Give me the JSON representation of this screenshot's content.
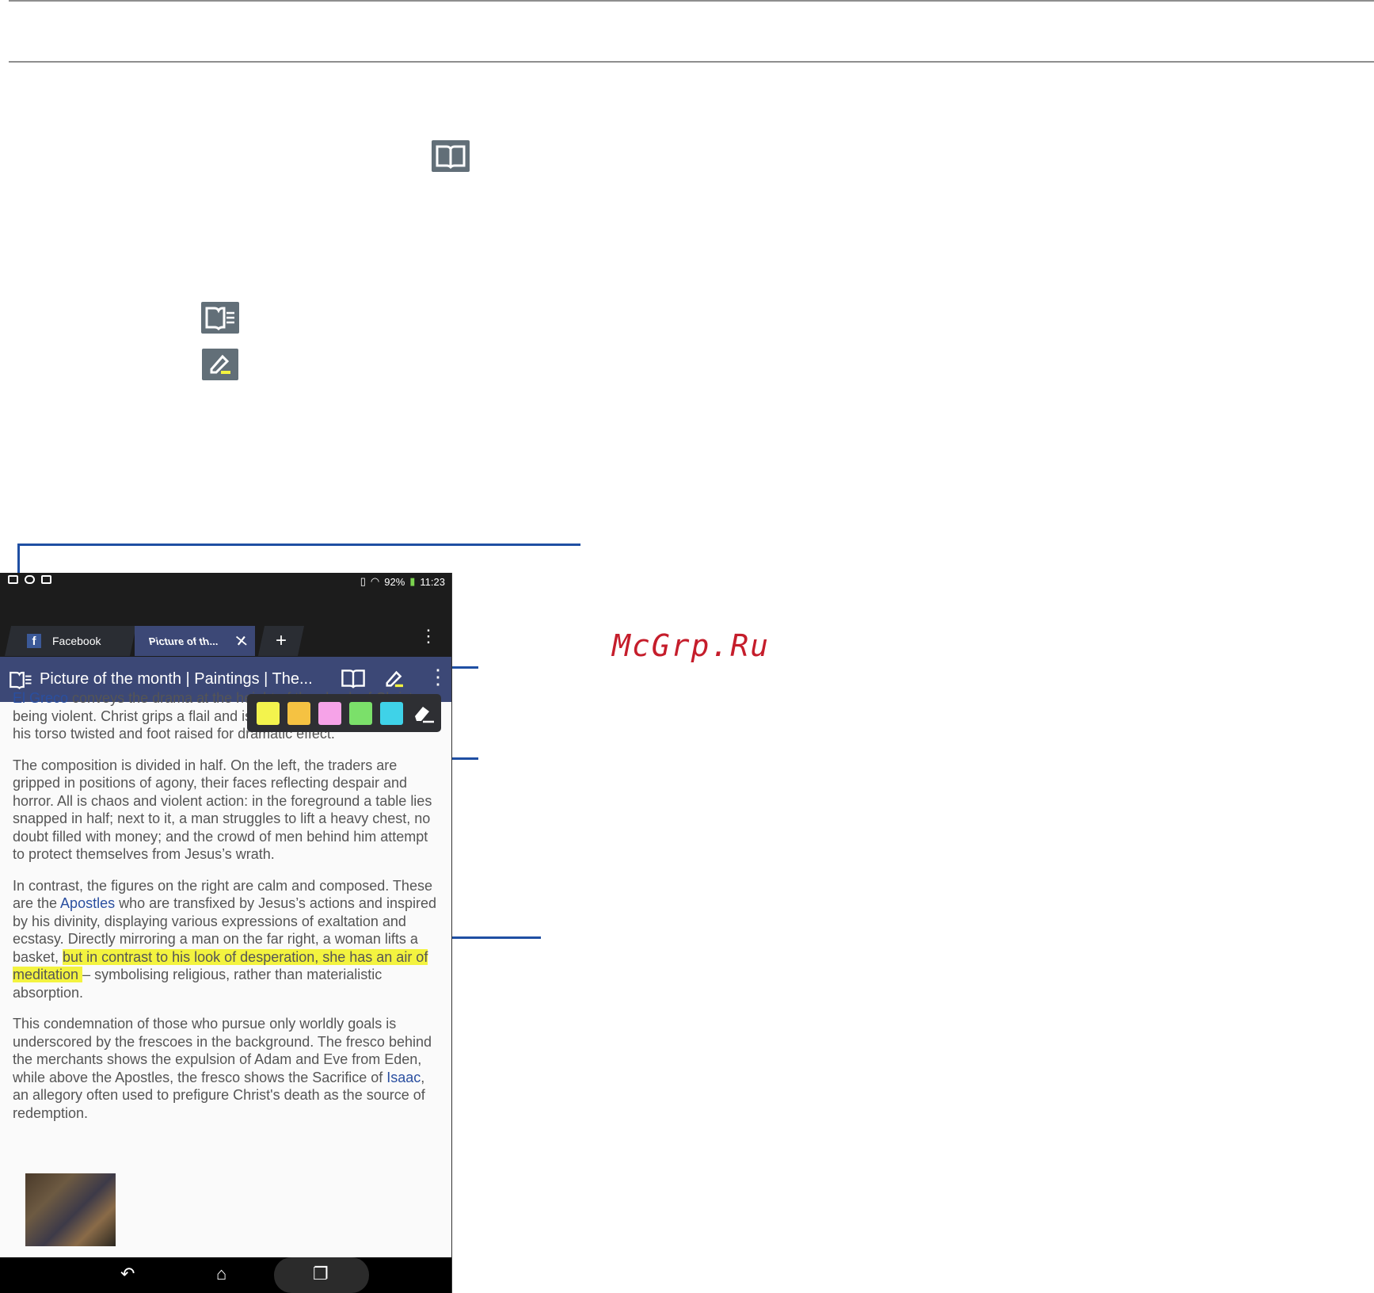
{
  "watermark": "McGrp.Ru",
  "statusbar": {
    "battery": "92%",
    "time": "11:23"
  },
  "tabs": [
    {
      "label": "Facebook"
    },
    {
      "label": "Picture of th..."
    }
  ],
  "toolbar": {
    "title": "Picture of the month | Paintings | The..."
  },
  "colors": {
    "accent": "#3c4876",
    "callout": "#1f4fa3",
    "highlight": "#f3f33f"
  },
  "palette": {
    "swatches": [
      "#f3f34d",
      "#f5c242",
      "#f6a3e8",
      "#7be06a",
      "#3fd2e8"
    ]
  },
  "article": {
    "p1": {
      "link": "El Greco",
      "rest": " conveys the drama at the height of the shock of Christ being violent. Christ grips a flail and is poised ready to unleash it – his torso twisted and foot raised for dramatic effect."
    },
    "p2": "The composition is divided in half. On the left, the traders are gripped in positions of agony, their faces reflecting despair and horror. All is chaos and violent action: in the foreground a table lies snapped in half; next to it, a man struggles to lift a heavy chest, no doubt filled with money; and the crowd of men behind him attempt to protect themselves from Jesus’s wrath.",
    "p3": {
      "a": "In contrast, the figures on the right are calm and composed. These are the ",
      "link": "Apostles",
      "b": " who are transfixed by Jesus’s actions and inspired by his divinity, displaying various expressions of exaltation and ecstasy. Directly mirroring a man on the far right, a woman lifts a basket, ",
      "highlight": "but in contrast to his look of desperation, she has an air of meditation ",
      "c": "– symbolising religious, rather than materialistic absorption."
    },
    "p4": {
      "a": "This condemnation of those who pursue only worldly goals is underscored by the frescoes in the background. The fresco behind the merchants shows the expulsion of Adam and Eve from Eden, while above the Apostles, the fresco shows the Sacrifice of ",
      "link": "Isaac",
      "b": ", an allegory often used to prefigure Christ's death as the source of redemption."
    }
  }
}
